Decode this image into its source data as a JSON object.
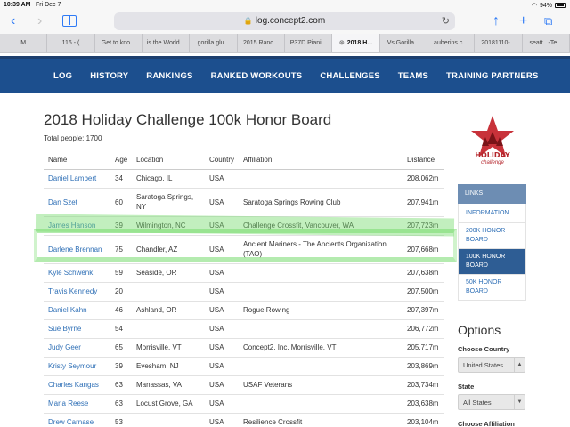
{
  "statusbar": {
    "time": "10:39 AM",
    "date": "Fri Dec 7",
    "battery": "94%"
  },
  "browser": {
    "url": "log.concept2.com",
    "tabs": [
      {
        "label": "M",
        "active": false
      },
      {
        "label": "116 - (",
        "active": false
      },
      {
        "label": "Get to kno...",
        "active": false
      },
      {
        "label": "is the World...",
        "active": false
      },
      {
        "label": "gorilla glu...",
        "active": false
      },
      {
        "label": "2015 Ranc...",
        "active": false
      },
      {
        "label": "P37D Piani...",
        "active": false
      },
      {
        "label": "2018 H...",
        "active": true
      },
      {
        "label": "Vs Gorilla...",
        "active": false
      },
      {
        "label": "auberins.c...",
        "active": false
      },
      {
        "label": "20181110-...",
        "active": false
      },
      {
        "label": "seatt...-Te...",
        "active": false
      }
    ]
  },
  "nav": [
    "LOG",
    "HISTORY",
    "RANKINGS",
    "RANKED WORKOUTS",
    "CHALLENGES",
    "TEAMS",
    "TRAINING PARTNERS"
  ],
  "page": {
    "title": "2018 Holiday Challenge 100k Honor Board",
    "total": "Total people: 1700"
  },
  "table": {
    "headers": {
      "name": "Name",
      "age": "Age",
      "location": "Location",
      "country": "Country",
      "affiliation": "Affiliation",
      "distance": "Distance"
    },
    "rows": [
      {
        "name": "Daniel Lambert",
        "age": "34",
        "location": "Chicago, IL",
        "country": "USA",
        "affiliation": "",
        "distance": "208,062m"
      },
      {
        "name": "Dan Szet",
        "age": "60",
        "location": "Saratoga Springs, NY",
        "country": "USA",
        "affiliation": "Saratoga Springs Rowing Club",
        "distance": "207,941m"
      },
      {
        "name": "James Hanson",
        "age": "39",
        "location": "Wilmington, NC",
        "country": "USA",
        "affiliation": "Challenge Crossfit, Vancouver, WA",
        "distance": "207,723m"
      },
      {
        "name": "Darlene Brennan",
        "age": "75",
        "location": "Chandler, AZ",
        "country": "USA",
        "affiliation": "Ancient Mariners - The Ancients Organization (TAO)",
        "distance": "207,668m"
      },
      {
        "name": "Kyle Schwenk",
        "age": "59",
        "location": "Seaside, OR",
        "country": "USA",
        "affiliation": "",
        "distance": "207,638m"
      },
      {
        "name": "Travis Kennedy",
        "age": "20",
        "location": "",
        "country": "USA",
        "affiliation": "",
        "distance": "207,500m"
      },
      {
        "name": "Daniel Kahn",
        "age": "46",
        "location": "Ashland, OR",
        "country": "USA",
        "affiliation": "Rogue Rowing",
        "distance": "207,397m"
      },
      {
        "name": "Sue Byrne",
        "age": "54",
        "location": "",
        "country": "USA",
        "affiliation": "",
        "distance": "206,772m"
      },
      {
        "name": "Judy Geer",
        "age": "65",
        "location": "Morrisville, VT",
        "country": "USA",
        "affiliation": "Concept2, Inc, Morrisville, VT",
        "distance": "205,717m"
      },
      {
        "name": "Kristy Seymour",
        "age": "39",
        "location": "Evesham, NJ",
        "country": "USA",
        "affiliation": "",
        "distance": "203,869m"
      },
      {
        "name": "Charles Kangas",
        "age": "63",
        "location": "Manassas, VA",
        "country": "USA",
        "affiliation": "USAF Veterans",
        "distance": "203,734m"
      },
      {
        "name": "Marla Reese",
        "age": "63",
        "location": "Locust Grove, GA",
        "country": "USA",
        "affiliation": "",
        "distance": "203,638m"
      },
      {
        "name": "Drew Carnase",
        "age": "53",
        "location": "",
        "country": "USA",
        "affiliation": "Resilience Crossfit",
        "distance": "203,104m"
      }
    ]
  },
  "logo": {
    "line1": "HOLIDAY",
    "line2": "challenge"
  },
  "sidebar": {
    "header": "LINKS",
    "items": [
      {
        "label": "INFORMATION",
        "active": false
      },
      {
        "label": "200K HONOR BOARD",
        "active": false
      },
      {
        "label": "100K HONOR BOARD",
        "active": true
      },
      {
        "label": "50K HONOR BOARD",
        "active": false
      }
    ]
  },
  "options": {
    "title": "Options",
    "country_label": "Choose Country",
    "country_value": "United States",
    "state_label": "State",
    "state_value": "All States",
    "affiliation_label": "Choose Affiliation"
  },
  "colors": {
    "navbar": "#1c4f8e",
    "link": "#2e6fb6",
    "highlight": "#78dc6e",
    "logo_red": "#b5262c"
  }
}
